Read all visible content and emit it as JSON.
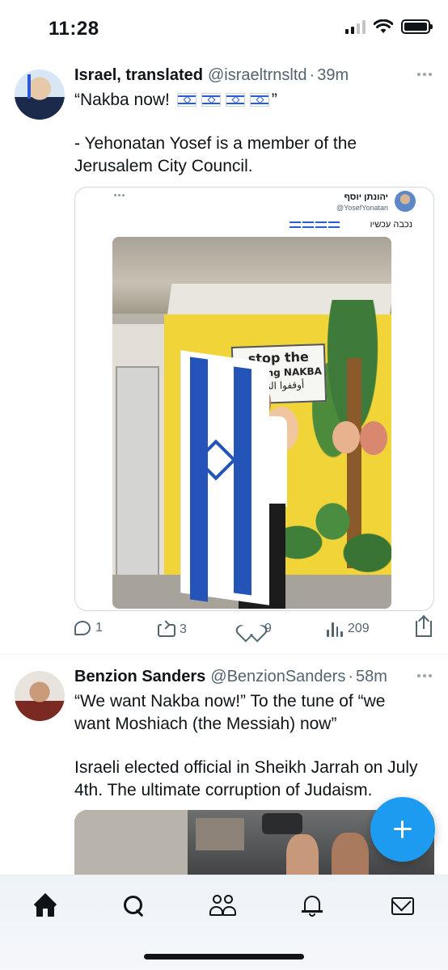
{
  "status_bar": {
    "time": "11:28",
    "battery_level": 1.0,
    "signal_bars_active": 2,
    "signal_bars_total": 4
  },
  "tweets": [
    {
      "author_name": "Israel, translated",
      "handle": "@israeltrnsltd",
      "separator": "·",
      "time": "39m",
      "text_quote_open": "“Nakba now!",
      "text_quote_close": "”",
      "flag_emoji_count": 4,
      "text_body_1": "- Yehonatan Yosef is a member of the",
      "text_body_2": "Jerusalem City Council.",
      "embedded": {
        "author": "יהונתן יוסף",
        "handle": "@YosefYonatan",
        "text": "נכבה עכשיו",
        "sign_line1": "stop the",
        "sign_line2": "ongoing NAKBA",
        "sign_line3": "أوقفوا النكبة"
      },
      "actions": {
        "replies": "1",
        "retweets": "3",
        "likes": "9",
        "views": "209"
      }
    },
    {
      "author_name": "Benzion Sanders",
      "handle": "@BenzionSanders",
      "separator": "·",
      "time": "58m",
      "text_line_1": "“We want Nakba now!” To the tune of “we",
      "text_line_2": "want Moshiach (the Messiah) now”",
      "text_line_3": "Israeli elected official in Sheikh Jarrah on July",
      "text_line_4": "4th. The ultimate corruption of Judaism."
    }
  ],
  "icons": {
    "reply": "reply-icon",
    "retweet": "retweet-icon",
    "like": "heart-icon",
    "views": "views-icon",
    "share": "share-icon",
    "compose": "plus-icon",
    "nav": [
      "home-icon",
      "search-icon",
      "communities-icon",
      "bell-icon",
      "mail-icon"
    ]
  },
  "colors": {
    "accent": "#1d9bf0",
    "text": "#0f1419",
    "secondary": "#536471"
  }
}
